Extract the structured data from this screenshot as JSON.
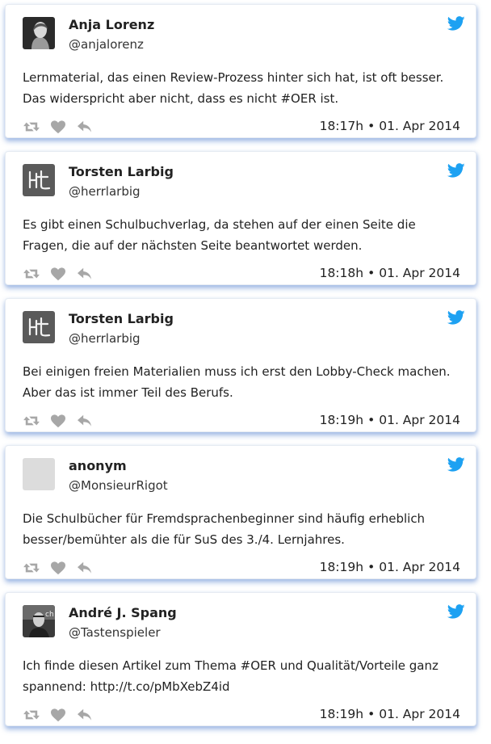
{
  "colors": {
    "twitter_blue": "#1da1f2",
    "action_gray": "#a7a7a7",
    "card_shadow": "#96b2e1"
  },
  "icons": {
    "brand": "twitter-bird-icon",
    "retweet": "retweet-icon",
    "like": "heart-icon",
    "reply": "reply-icon"
  },
  "tweets": [
    {
      "name": "Anja Lorenz",
      "handle": "@anjalorenz",
      "avatar": "photo-woman",
      "text": "Lernmaterial, das einen Review-Prozess hinter sich hat, ist oft besser. Das widerspricht aber nicht, dass es nicht #OER ist.",
      "time": "18:17h",
      "date": "01. Apr 2014"
    },
    {
      "name": "Torsten Larbig",
      "handle": "@herrlarbig",
      "avatar": "Ht-logo",
      "text": "Es gibt einen Schulbuchverlag, da stehen auf der einen Seite die Fragen, die auf der nächsten Seite beantwortet werden.",
      "time": "18:18h",
      "date": "01. Apr 2014"
    },
    {
      "name": "Torsten Larbig",
      "handle": "@herrlarbig",
      "avatar": "Ht-logo",
      "text": "Bei einigen freien Materialien muss ich erst den Lobby-Check machen. Aber das ist immer Teil des Berufs.",
      "time": "18:19h",
      "date": "01. Apr 2014"
    },
    {
      "name": "anonym",
      "handle": "@MonsieurRigot",
      "avatar": "placeholder",
      "text": "Die Schulbücher für Fremdsprachenbeginner sind häufig erheblich besser/bemühter als die für SuS des 3./4. Lernjahres.",
      "time": "18:19h",
      "date": "01. Apr 2014"
    },
    {
      "name": "André J. Spang",
      "handle": "@Tastenspieler",
      "avatar": "photo-man",
      "text_before_link": "Ich finde diesen Artikel zum Thema #OER und Qualität/Vorteile ganz spannend: ",
      "link": "http://t.co/pMbXebZ4id",
      "time": "18:19h",
      "date": "01. Apr 2014"
    }
  ]
}
